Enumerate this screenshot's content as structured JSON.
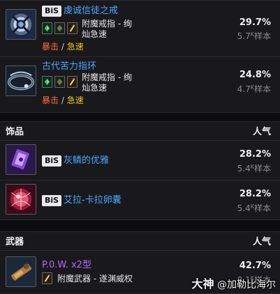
{
  "rings": [
    {
      "bis": "BiS",
      "name": "虔诚信徒之戒",
      "enchant_line1": "附魔戒指 - 绚",
      "enchant_line2": "灿急速",
      "stat_a": "暴击",
      "slash": "/",
      "stat_b": "急速",
      "percent": "29.7%",
      "samples_num": "5.7",
      "samples_sup": "K",
      "samples_unit": "样本"
    },
    {
      "name": "古代苦力指环",
      "enchant_line1": "附魔戒指 - 绚",
      "enchant_line2": "灿急速",
      "stat_a": "暴击",
      "slash": "/",
      "stat_b": "急速",
      "percent": "24.8%",
      "samples_num": "4.7",
      "samples_sup": "K",
      "samples_unit": "样本"
    }
  ],
  "trinkets": {
    "title": "饰品",
    "col": "人气",
    "items": [
      {
        "bis": "BiS",
        "name": "灰鳞的优雅",
        "percent": "28.2%",
        "samples_num": "5.4",
        "samples_sup": "K",
        "samples_unit": "样本"
      },
      {
        "bis": "BiS",
        "name": "艾拉-卡拉卵囊",
        "percent": "28.2%",
        "samples_num": "5.4",
        "samples_sup": "K",
        "samples_unit": "样本"
      }
    ]
  },
  "weapons": {
    "title": "武器",
    "col": "人气",
    "items": [
      {
        "name": "P.0.W. x2型",
        "enchant": "附魔武器 - 遂渊威权",
        "percent": "42.7%",
        "samples_num": "8.1",
        "samples_sup": "K",
        "samples_unit": "样本"
      }
    ]
  },
  "watermark": {
    "brand": "大神",
    "handle": "@加勒比海尔"
  },
  "colors": {
    "item_blue": "#4aa6ff",
    "item_purple": "#b36cff",
    "crit": "#ff6a3d",
    "haste": "#f0c419"
  }
}
